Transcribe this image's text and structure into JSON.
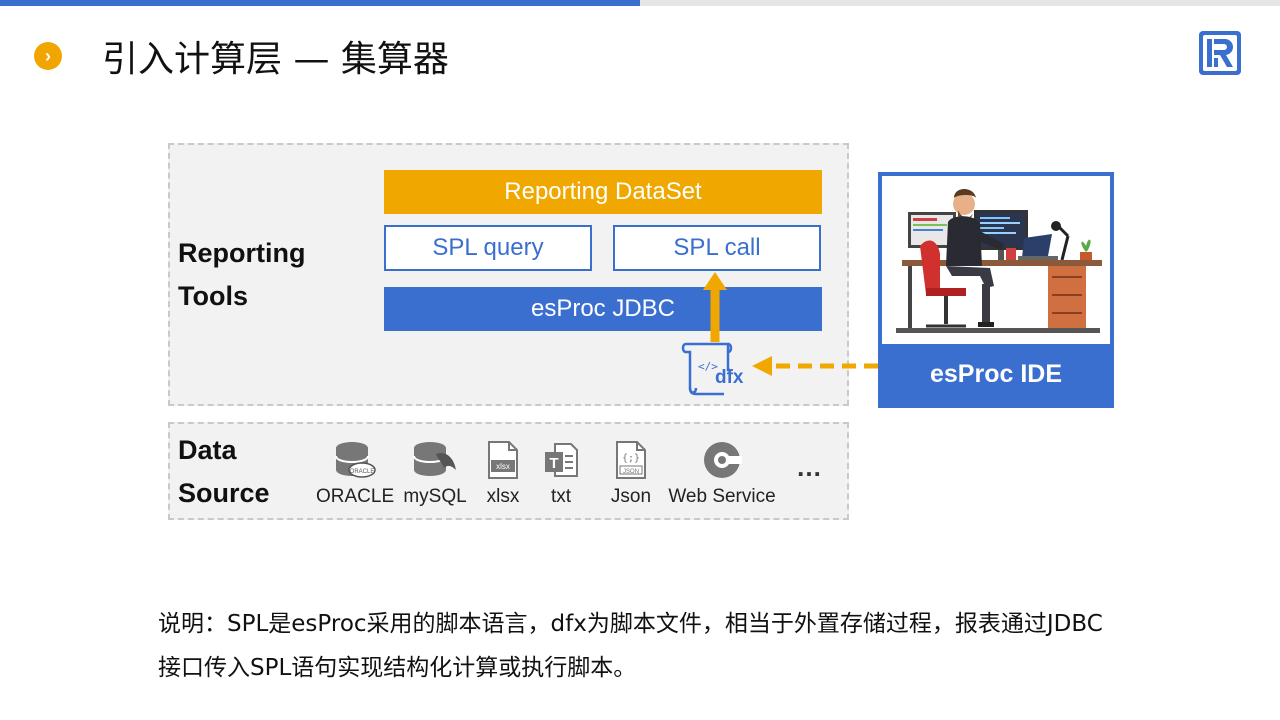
{
  "header": {
    "title": "引入计算层 — 集算器",
    "bullet_icon": "chevron-right-icon",
    "logo_icon": "r-logo-icon"
  },
  "diagram": {
    "reporting_label": [
      "Reporting",
      "Tools"
    ],
    "reporting_dataset": "Reporting DataSet",
    "spl_query": "SPL query",
    "spl_call": "SPL call",
    "esproc_jdbc": "esProc JDBC",
    "dfx_label": "dfx",
    "ide_label": "esProc IDE",
    "data_source_label": [
      "Data",
      "Source"
    ],
    "sources": [
      "ORACLE",
      "mySQL",
      "xlsx",
      "txt",
      "Json",
      "Web Service"
    ],
    "ellipsis": "…",
    "colors": {
      "blue": "#3a6fd0",
      "orange": "#f0a800",
      "panel": "#f2f2f2"
    }
  },
  "note": {
    "line1": "说明：SPL是esProc采用的脚本语言，dfx为脚本文件，相当于外置存储过程，报表通过JDBC",
    "line2": "接口传入SPL语句实现结构化计算或执行脚本。"
  }
}
